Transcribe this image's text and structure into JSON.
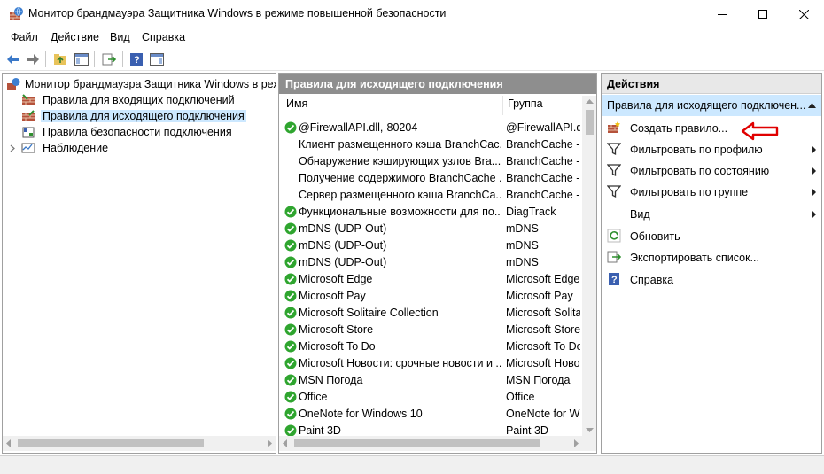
{
  "window": {
    "title": "Монитор брандмауэра Защитника Windows в режиме повышенной безопасности"
  },
  "menu": [
    "Файл",
    "Действие",
    "Вид",
    "Справка"
  ],
  "tree": {
    "root": "Монитор брандмауэра Защитника Windows в реж",
    "items": [
      {
        "label": "Правила для входящих подключений",
        "selected": false
      },
      {
        "label": "Правила для исходящего подключения",
        "selected": true
      },
      {
        "label": "Правила безопасности подключения",
        "selected": false
      },
      {
        "label": "Наблюдение",
        "selected": false
      }
    ]
  },
  "rules": {
    "header": "Правила для исходящего подключения",
    "col_name": "Имя",
    "col_group": "Группа",
    "rows": [
      {
        "name": "@FirewallAPI.dll,-80204",
        "group": "@FirewallAPI.dll",
        "enabled": true
      },
      {
        "name": "Клиент размещенного кэша BranchCac...",
        "group": "BranchCache - ",
        "enabled": false
      },
      {
        "name": "Обнаружение кэширующих узлов Bra...",
        "group": "BranchCache - ",
        "enabled": false
      },
      {
        "name": "Получение содержимого BranchCache ...",
        "group": "BranchCache - ",
        "enabled": false
      },
      {
        "name": "Сервер размещенного кэша BranchCa...",
        "group": "BranchCache - ",
        "enabled": false
      },
      {
        "name": "Функциональные возможности для по...",
        "group": "DiagTrack",
        "enabled": true
      },
      {
        "name": "mDNS (UDP-Out)",
        "group": "mDNS",
        "enabled": true
      },
      {
        "name": "mDNS (UDP-Out)",
        "group": "mDNS",
        "enabled": true
      },
      {
        "name": "mDNS (UDP-Out)",
        "group": "mDNS",
        "enabled": true
      },
      {
        "name": "Microsoft Edge",
        "group": "Microsoft Edge",
        "enabled": true
      },
      {
        "name": "Microsoft Pay",
        "group": "Microsoft Pay",
        "enabled": true
      },
      {
        "name": "Microsoft Solitaire Collection",
        "group": "Microsoft Solita",
        "enabled": true
      },
      {
        "name": "Microsoft Store",
        "group": "Microsoft Store",
        "enabled": true
      },
      {
        "name": "Microsoft To Do",
        "group": "Microsoft To Do",
        "enabled": true
      },
      {
        "name": "Microsoft Новости: срочные новости и ...",
        "group": "Microsoft Ново",
        "enabled": true
      },
      {
        "name": "MSN Погода",
        "group": "MSN Погода",
        "enabled": true
      },
      {
        "name": "Office",
        "group": "Office",
        "enabled": true
      },
      {
        "name": "OneNote for Windows 10",
        "group": "OneNote for Wi",
        "enabled": true
      },
      {
        "name": "Paint 3D",
        "group": "Paint 3D",
        "enabled": true
      }
    ]
  },
  "actions": {
    "header": "Действия",
    "section": "Правила для исходящего подключен...",
    "items": [
      {
        "label": "Создать правило...",
        "icon": "new-rule-icon",
        "submenu": false
      },
      {
        "label": "Фильтровать по профилю",
        "icon": "filter-icon",
        "submenu": true
      },
      {
        "label": "Фильтровать по состоянию",
        "icon": "filter-icon",
        "submenu": true
      },
      {
        "label": "Фильтровать по группе",
        "icon": "filter-icon",
        "submenu": true
      },
      {
        "label": "Вид",
        "icon": "",
        "submenu": true
      },
      {
        "label": "Обновить",
        "icon": "refresh-icon",
        "submenu": false
      },
      {
        "label": "Экспортировать список...",
        "icon": "export-icon",
        "submenu": false
      },
      {
        "label": "Справка",
        "icon": "help-icon",
        "submenu": false
      }
    ]
  },
  "colors": {
    "selection": "#cce8ff",
    "header_gray": "#8e8e8e",
    "check_green": "#2fa52f",
    "annotation_arrow": "#e00000"
  }
}
